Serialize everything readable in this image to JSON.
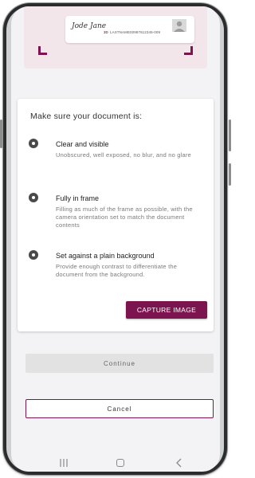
{
  "document_preview": {
    "signature_text": "Jode Jane",
    "mrz_marker": "3D",
    "mrz_text": "LASTNAME00987612345-009"
  },
  "instructions": {
    "title": "Make sure your document is:",
    "items": [
      {
        "title": "Clear and visible",
        "description": "Unobscured, well exposed, no blur, and no glare"
      },
      {
        "title": "Fully in frame",
        "description": "Filling as much of the frame as possible, with the camera orientation set to match the document contents"
      },
      {
        "title": "Set against a plain background",
        "description": "Provide enough contrast to differentiate the document from the background."
      }
    ],
    "capture_button_label": "CAPTURE IMAGE"
  },
  "actions": {
    "continue_label": "Continue",
    "cancel_label": "Cancel"
  },
  "navbar": {
    "recents_icon": "recents-icon",
    "home_icon": "home-icon",
    "back_icon": "back-icon"
  },
  "colors": {
    "accent": "#7c1450",
    "preview_background": "#f3e6ea",
    "screen_background": "#f3f2f4",
    "disabled_button": "#e2e2e3"
  }
}
